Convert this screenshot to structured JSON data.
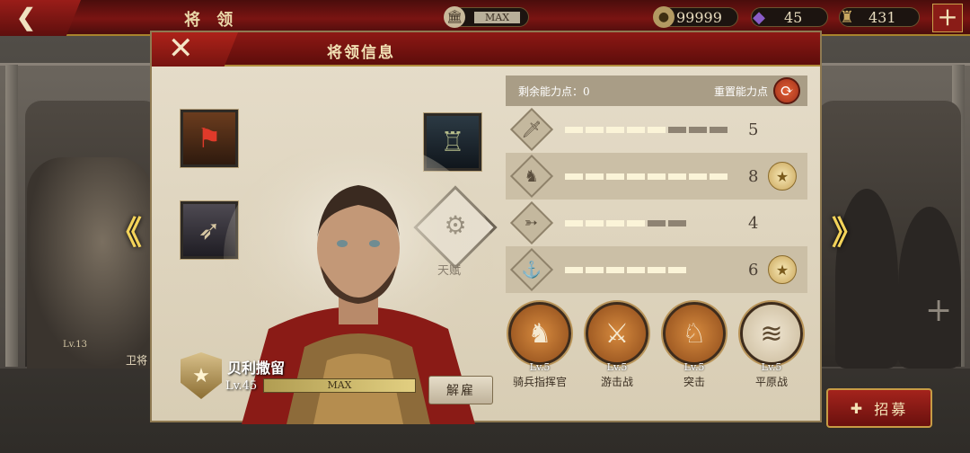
{
  "topbar": {
    "back_icon": "chevron-left-icon",
    "title": "将 领",
    "building_level": "MAX",
    "coins": "99999",
    "gems": "45",
    "helmet_res": "431",
    "plus": "+"
  },
  "background": {
    "left_general": {
      "level": "Lv.13",
      "rank": "卫将"
    },
    "left_arrow": "《",
    "right_arrow": "》",
    "side_plus": "+",
    "recruit_label": "招募"
  },
  "dialog": {
    "title": "将领信息",
    "close_icon": "close-icon",
    "talent_label": "天赋",
    "hero": {
      "name": "贝利撒留",
      "level": "Lv.45",
      "xp_text": "MAX"
    },
    "dismiss_label": "解雇",
    "points": {
      "remaining_label": "剩余能力点：",
      "remaining_value": "0",
      "reset_label": "重置能力点"
    },
    "stats": [
      {
        "icon": "sword-icon",
        "value": "5",
        "filled": 5,
        "total": 8,
        "medal": false
      },
      {
        "icon": "horse-icon",
        "value": "8",
        "filled": 8,
        "total": 8,
        "medal": true
      },
      {
        "icon": "bow-icon",
        "value": "4",
        "filled": 4,
        "total": 6,
        "medal": false
      },
      {
        "icon": "anchor-icon",
        "value": "6",
        "filled": 6,
        "total": 6,
        "medal": true
      }
    ],
    "skills": [
      {
        "level": "Lv.5",
        "name": "骑兵指挥官",
        "icon": "horse-head-icon"
      },
      {
        "level": "Lv.5",
        "name": "游击战",
        "icon": "soldiers-icon"
      },
      {
        "level": "Lv.5",
        "name": "突击",
        "icon": "cavalry-charge-icon"
      },
      {
        "level": "Lv.5",
        "name": "平原战",
        "icon": "plains-icon"
      }
    ]
  },
  "colors": {
    "crimson": "#8e1814",
    "gold": "#c9a24a",
    "parchment": "#e6ddca"
  }
}
